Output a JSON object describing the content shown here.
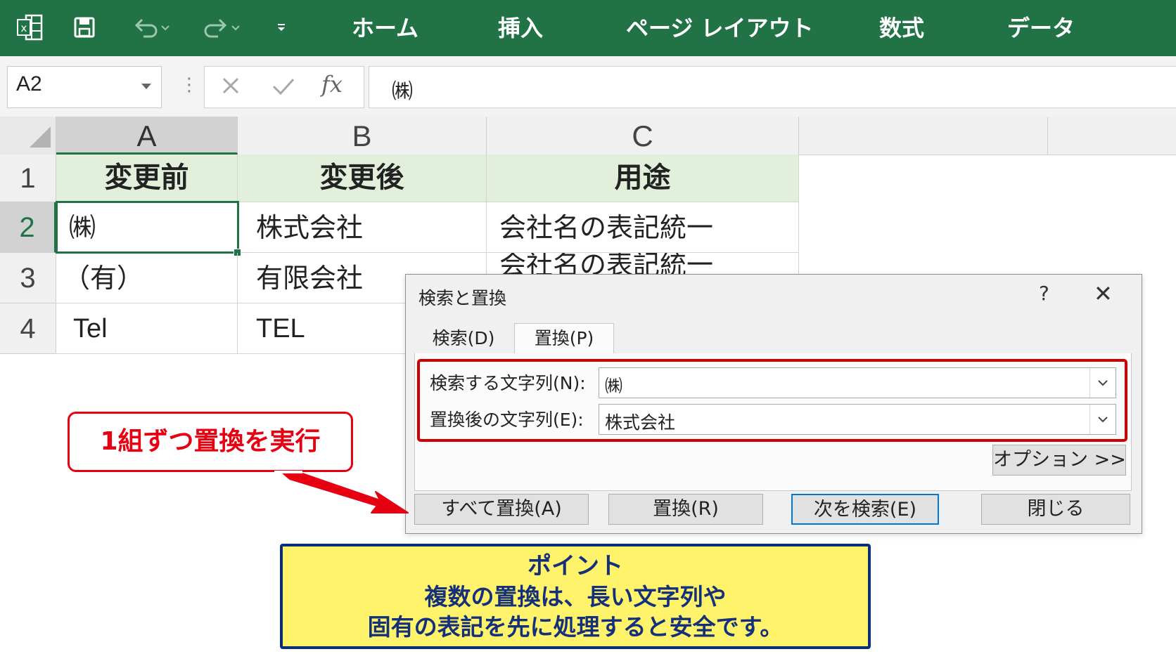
{
  "ribbon": {
    "tabs": [
      "ホーム",
      "挿入",
      "ページ レイアウト",
      "数式",
      "データ"
    ]
  },
  "formula_bar": {
    "name_box": "A2",
    "fx_label": "fx",
    "content": "㈱"
  },
  "sheet": {
    "columns": [
      "A",
      "B",
      "C"
    ],
    "row_numbers": [
      "1",
      "2",
      "3",
      "4"
    ],
    "header_row": [
      "変更前",
      "変更後",
      "用途"
    ],
    "rows": [
      [
        "㈱",
        "株式会社",
        "会社名の表記統一"
      ],
      [
        "（有）",
        "有限会社",
        "会社名の表記統一"
      ],
      [
        "Tel",
        "TEL",
        ""
      ]
    ],
    "selected_cell": "A2",
    "header_fill_color": "#e2efda",
    "accent_color": "#217346"
  },
  "dialog": {
    "title": "検索と置換",
    "help": "?",
    "close": "✕",
    "tabs": [
      "検索(D)",
      "置換(P)"
    ],
    "active_tab": "置換(P)",
    "find_label": "検索する文字列(N):",
    "find_value": "㈱",
    "replace_label": "置換後の文字列(E):",
    "replace_value": "株式会社",
    "options_button": "オプション >>",
    "buttons": {
      "replace_all": "すべて置換(A)",
      "replace": "置換(R)",
      "find_next": "次を検索(E)",
      "close": "閉じる"
    }
  },
  "callout": {
    "text": "1組ずつ置換を実行",
    "color": "#e60012"
  },
  "point": {
    "title": "ポイント",
    "line1": "複数の置換は、長い文字列や",
    "line2": "固有の表記を先に処理すると安全です。",
    "background": "#fff36b",
    "border": "#0a2d78"
  }
}
